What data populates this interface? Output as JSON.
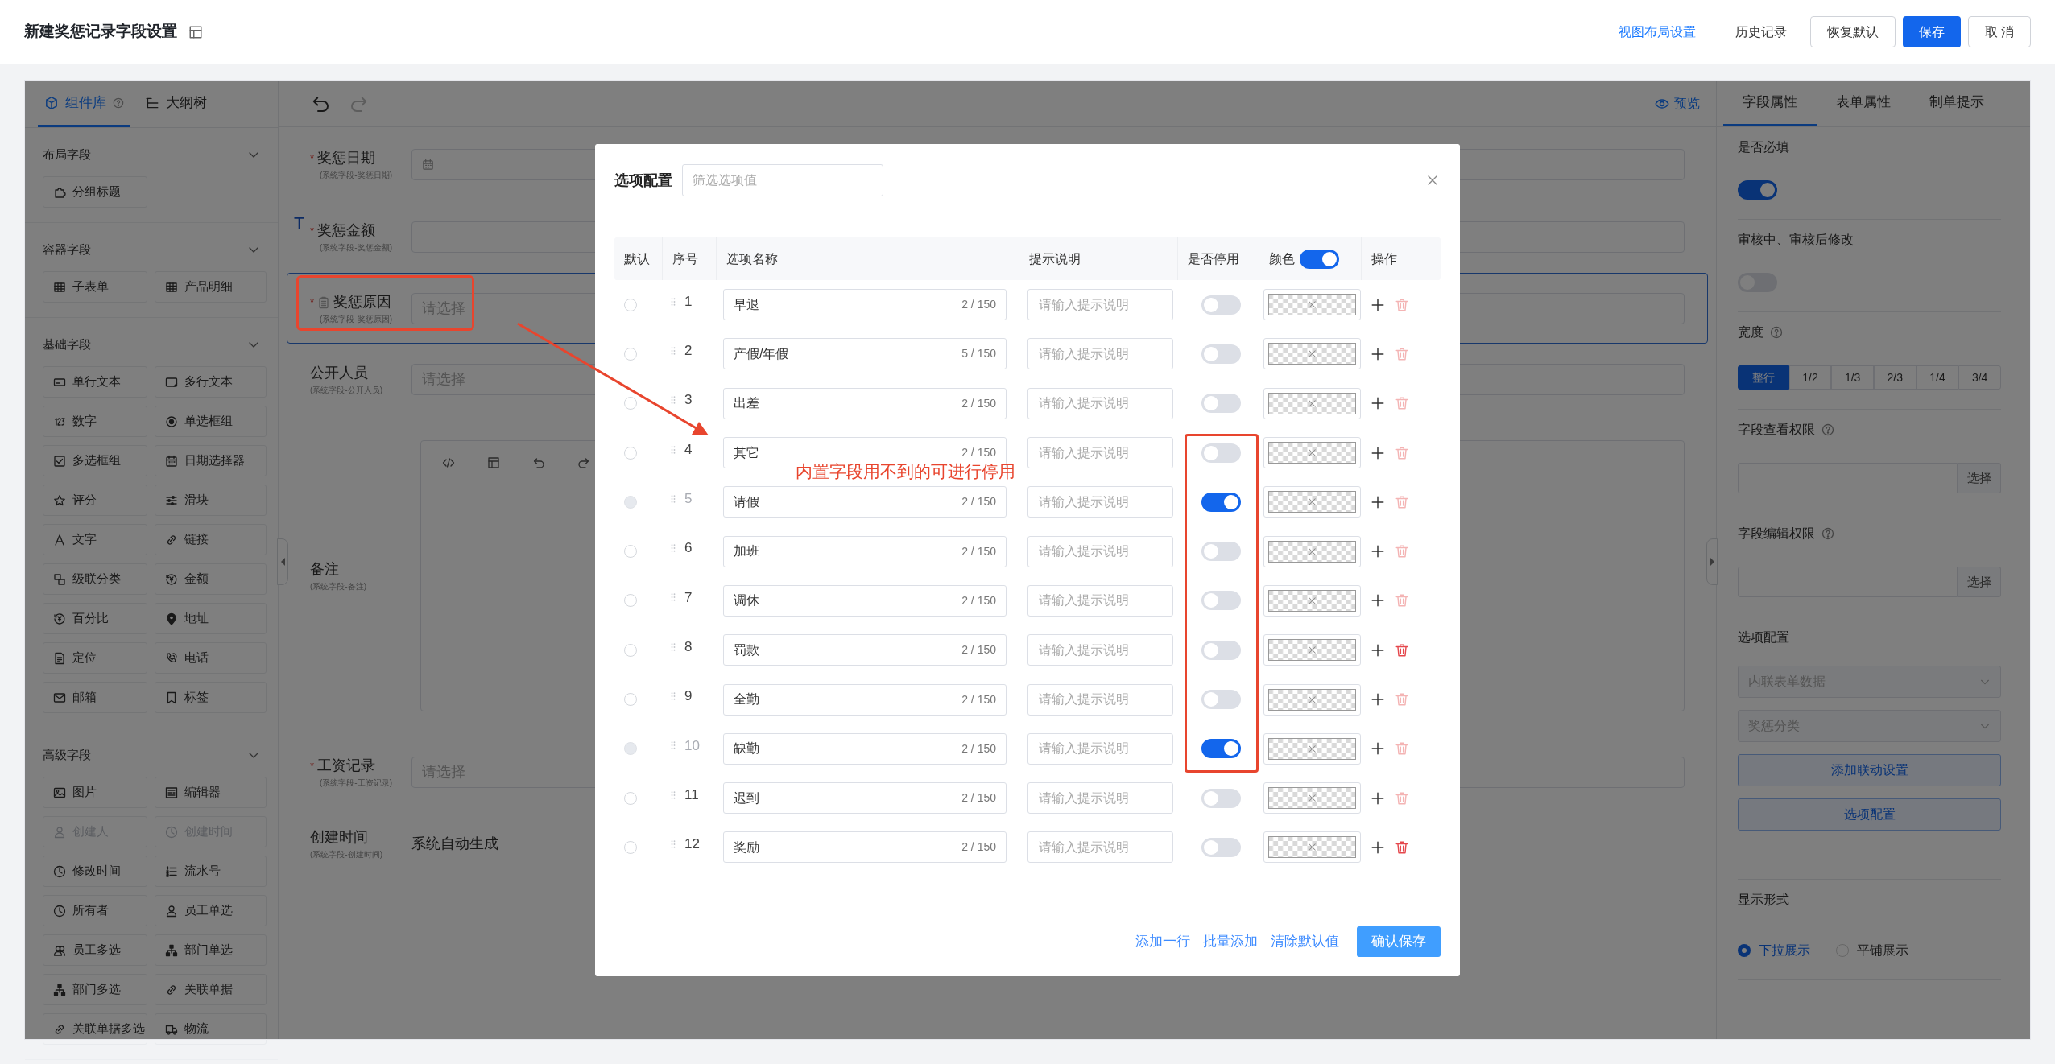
{
  "header": {
    "title": "新建奖惩记录字段设置",
    "actions": [
      {
        "label": "视图布局设置",
        "kind": "link"
      },
      {
        "label": "历史记录",
        "kind": "text"
      },
      {
        "label": "恢复默认",
        "kind": "default"
      },
      {
        "label": "保存",
        "kind": "primary"
      },
      {
        "label": "取 消",
        "kind": "default"
      }
    ]
  },
  "left_panel": {
    "tabs": [
      {
        "label": "组件库",
        "selected": true
      },
      {
        "label": "大纲树",
        "selected": false
      }
    ],
    "groups": [
      {
        "title": "布局字段",
        "expanded": true,
        "items": [
          {
            "label": "分组标题",
            "disabled": false
          }
        ]
      },
      {
        "title": "容器字段",
        "expanded": true,
        "items": [
          {
            "label": "子表单",
            "disabled": false
          },
          {
            "label": "产品明细",
            "disabled": false
          }
        ]
      },
      {
        "title": "基础字段",
        "expanded": true,
        "items": [
          {
            "label": "单行文本",
            "disabled": false
          },
          {
            "label": "多行文本",
            "disabled": false
          },
          {
            "label": "数字",
            "disabled": false
          },
          {
            "label": "单选框组",
            "disabled": false
          },
          {
            "label": "多选框组",
            "disabled": false
          },
          {
            "label": "日期选择器",
            "disabled": false
          },
          {
            "label": "评分",
            "disabled": false
          },
          {
            "label": "滑块",
            "disabled": false
          },
          {
            "label": "文字",
            "disabled": false
          },
          {
            "label": "链接",
            "disabled": false
          },
          {
            "label": "级联分类",
            "disabled": false
          },
          {
            "label": "金额",
            "disabled": false
          },
          {
            "label": "百分比",
            "disabled": false
          },
          {
            "label": "地址",
            "disabled": false
          },
          {
            "label": "定位",
            "disabled": false
          },
          {
            "label": "电话",
            "disabled": false
          },
          {
            "label": "邮箱",
            "disabled": false
          },
          {
            "label": "标签",
            "disabled": false
          }
        ]
      },
      {
        "title": "高级字段",
        "expanded": true,
        "items": [
          {
            "label": "图片",
            "disabled": false
          },
          {
            "label": "编辑器",
            "disabled": false
          },
          {
            "label": "创建人",
            "disabled": true
          },
          {
            "label": "创建时间",
            "disabled": true
          },
          {
            "label": "修改时间",
            "disabled": false
          },
          {
            "label": "流水号",
            "disabled": false
          },
          {
            "label": "所有者",
            "disabled": false
          },
          {
            "label": "员工单选",
            "disabled": false
          },
          {
            "label": "员工多选",
            "disabled": false
          },
          {
            "label": "部门单选",
            "disabled": false
          },
          {
            "label": "部门多选",
            "disabled": false
          },
          {
            "label": "关联单据",
            "disabled": false
          },
          {
            "label": "关联单据多选",
            "disabled": false
          },
          {
            "label": "物流",
            "disabled": false
          }
        ]
      }
    ]
  },
  "canvas": {
    "preview": "预览",
    "insert_marker": "T",
    "required_mark": "*",
    "fields": [
      {
        "label": "奖惩日期",
        "note": "(系统字段-奖惩日期)",
        "required": true,
        "kind": "date",
        "selected": false
      },
      {
        "label": "奖惩金额",
        "note": "(系统字段-奖惩金额)",
        "required": true,
        "kind": "input",
        "selected": false
      },
      {
        "label": "奖惩原因",
        "note": "(系统字段-奖惩原因)",
        "required": true,
        "kind": "select",
        "placeholder": "请选择",
        "selected": true
      },
      {
        "label": "公开人员",
        "note": "(系统字段-公开人员)",
        "required": false,
        "kind": "select",
        "placeholder": "请选择",
        "selected": false
      },
      {
        "label": "备注",
        "note": "(系统字段-备注)",
        "required": false,
        "kind": "editor",
        "selected": false
      },
      {
        "label": "工资记录",
        "note": "(系统字段-工资记录)",
        "required": true,
        "kind": "select",
        "placeholder": "请选择",
        "selected": false
      },
      {
        "label": "创建时间",
        "note": "(系统字段-创建时间)",
        "required": false,
        "kind": "static",
        "value": "系统自动生成",
        "selected": false
      }
    ]
  },
  "right_panel": {
    "tabs": [
      {
        "label": "字段属性",
        "selected": true
      },
      {
        "label": "表单属性",
        "selected": false
      },
      {
        "label": "制单提示",
        "selected": false
      }
    ],
    "sections": [
      {
        "kind": "switch",
        "label": "是否必填",
        "on": true
      },
      {
        "kind": "switch",
        "label": "审核中、审核后修改",
        "on": false
      },
      {
        "kind": "segments",
        "label": "宽度",
        "help": true,
        "options": [
          {
            "label": "整行",
            "selected": true
          },
          {
            "label": "1/2",
            "selected": false
          },
          {
            "label": "1/3",
            "selected": false
          },
          {
            "label": "2/3",
            "selected": false
          },
          {
            "label": "1/4",
            "selected": false
          },
          {
            "label": "3/4",
            "selected": false
          }
        ]
      },
      {
        "kind": "picker",
        "label": "字段查看权限",
        "help": true,
        "button": "选择"
      },
      {
        "kind": "picker",
        "label": "字段编辑权限",
        "help": true,
        "button": "选择"
      },
      {
        "kind": "options",
        "label": "选项配置",
        "selects": [
          "内联表单数据",
          "奖惩分类"
        ],
        "buttons": [
          "添加联动设置",
          "选项配置"
        ]
      },
      {
        "kind": "radios",
        "label": "显示形式",
        "options": [
          {
            "label": "下拉展示",
            "selected": true
          },
          {
            "label": "平铺展示",
            "selected": false
          }
        ]
      }
    ]
  },
  "dialog": {
    "title": "选项配置",
    "filter_placeholder": "筛选选项值",
    "columns": [
      "默认",
      "序号",
      "选项名称",
      "提示说明",
      "是否停用",
      "颜色",
      "操作"
    ],
    "color_enabled": true,
    "rows": [
      {
        "index": "1",
        "name": "早退",
        "count": "2 / 150",
        "hint_placeholder": "请输入提示说明",
        "default": false,
        "stopped": false,
        "deletable": false
      },
      {
        "index": "2",
        "name": "产假/年假",
        "count": "5 / 150",
        "hint_placeholder": "请输入提示说明",
        "default": false,
        "stopped": false,
        "deletable": false
      },
      {
        "index": "3",
        "name": "出差",
        "count": "2 / 150",
        "hint_placeholder": "请输入提示说明",
        "default": false,
        "stopped": false,
        "deletable": false
      },
      {
        "index": "4",
        "name": "其它",
        "count": "2 / 150",
        "hint_placeholder": "请输入提示说明",
        "default": false,
        "stopped": false,
        "deletable": false
      },
      {
        "index": "5",
        "name": "请假",
        "count": "2 / 150",
        "hint_placeholder": "请输入提示说明",
        "default": false,
        "stopped": true,
        "deletable": false
      },
      {
        "index": "6",
        "name": "加班",
        "count": "2 / 150",
        "hint_placeholder": "请输入提示说明",
        "default": false,
        "stopped": false,
        "deletable": false
      },
      {
        "index": "7",
        "name": "调休",
        "count": "2 / 150",
        "hint_placeholder": "请输入提示说明",
        "default": false,
        "stopped": false,
        "deletable": false
      },
      {
        "index": "8",
        "name": "罚款",
        "count": "2 / 150",
        "hint_placeholder": "请输入提示说明",
        "default": false,
        "stopped": false,
        "deletable": true
      },
      {
        "index": "9",
        "name": "全勤",
        "count": "2 / 150",
        "hint_placeholder": "请输入提示说明",
        "default": false,
        "stopped": false,
        "deletable": false
      },
      {
        "index": "10",
        "name": "缺勤",
        "count": "2 / 150",
        "hint_placeholder": "请输入提示说明",
        "default": false,
        "stopped": true,
        "deletable": false
      },
      {
        "index": "11",
        "name": "迟到",
        "count": "2 / 150",
        "hint_placeholder": "请输入提示说明",
        "default": false,
        "stopped": false,
        "deletable": false
      },
      {
        "index": "12",
        "name": "奖励",
        "count": "2 / 150",
        "hint_placeholder": "请输入提示说明",
        "default": false,
        "stopped": false,
        "deletable": true
      }
    ],
    "links": [
      "添加一行",
      "批量添加",
      "清除默认值"
    ],
    "confirm": "确认保存"
  },
  "annotation": {
    "note": "内置字段用不到的可进行停用"
  }
}
